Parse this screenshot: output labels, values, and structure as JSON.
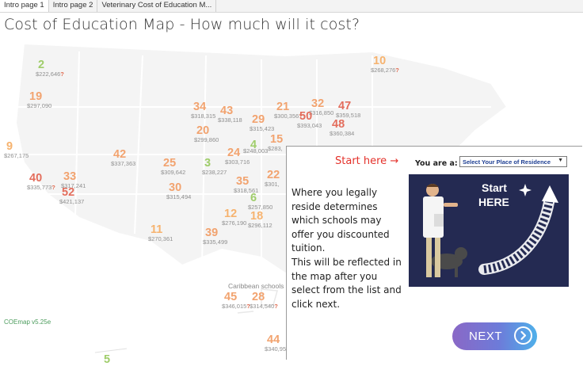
{
  "tabs": [
    "Intro page 1",
    "Intro page 2",
    "Veterinary Cost of Education M..."
  ],
  "title": "Cost of Education Map - How much will it cost?",
  "version": "COEmap v5.25e",
  "caribbean_label": "Caribbean schools",
  "colors": {
    "green": "#9fcd6a",
    "orange": "#f2a36f",
    "red": "#e36d5c",
    "panel_bg": "#242a52",
    "accent_red": "#e4322b",
    "select_text": "#1e3f93"
  },
  "map_markers": [
    {
      "id": "m2",
      "number": "2",
      "cost": "$222,646",
      "flag": "?",
      "color": "green"
    },
    {
      "id": "m10",
      "number": "10",
      "cost": "$268,276",
      "flag": "?",
      "color": "lorange"
    },
    {
      "id": "m19",
      "number": "19",
      "cost": "$297,090",
      "flag": "",
      "color": "orange"
    },
    {
      "id": "m34",
      "number": "34",
      "cost": "$318,315",
      "flag": "",
      "color": "orange"
    },
    {
      "id": "m43",
      "number": "43",
      "cost": "$338,118",
      "flag": "",
      "color": "orange"
    },
    {
      "id": "m21",
      "number": "21",
      "cost": "$300,356",
      "flag": "?",
      "color": "orange"
    },
    {
      "id": "m32",
      "number": "32",
      "cost": "$316,850",
      "flag": "",
      "color": "orange"
    },
    {
      "id": "m47",
      "number": "47",
      "cost": "$359,518",
      "flag": "",
      "color": "red"
    },
    {
      "id": "m29",
      "number": "29",
      "cost": "$315,423",
      "flag": "",
      "color": "orange"
    },
    {
      "id": "m50",
      "number": "50",
      "cost": "$393,043",
      "flag": "",
      "color": "red"
    },
    {
      "id": "m48",
      "number": "48",
      "cost": "$360,384",
      "flag": "",
      "color": "red"
    },
    {
      "id": "m20",
      "number": "20",
      "cost": "$299,860",
      "flag": "",
      "color": "orange"
    },
    {
      "id": "m15",
      "number": "15",
      "cost": "$283,",
      "flag": "",
      "color": "orange"
    },
    {
      "id": "m9",
      "number": "9",
      "cost": "$267,175",
      "flag": "",
      "color": "lorange"
    },
    {
      "id": "m4",
      "number": "4",
      "cost": "",
      "flag": "",
      "color": "green"
    },
    {
      "id": "m24",
      "number": "24",
      "cost": "$303,716",
      "flag": "",
      "color": "orange"
    },
    {
      "id": "m24b",
      "number": "",
      "cost": "$248,003",
      "flag": "",
      "color": "orange"
    },
    {
      "id": "m42",
      "number": "42",
      "cost": "$337,363",
      "flag": "",
      "color": "orange"
    },
    {
      "id": "m25",
      "number": "25",
      "cost": "$309,642",
      "flag": "",
      "color": "orange"
    },
    {
      "id": "m3",
      "number": "3",
      "cost": "$238,227",
      "flag": "",
      "color": "green"
    },
    {
      "id": "m22",
      "number": "22",
      "cost": "$301,",
      "flag": "",
      "color": "orange"
    },
    {
      "id": "m35",
      "number": "35",
      "cost": "$318,561",
      "flag": "",
      "color": "orange"
    },
    {
      "id": "m40",
      "number": "40",
      "cost": "$335,773",
      "flag": "?",
      "color": "red"
    },
    {
      "id": "m33",
      "number": "33",
      "cost": "$317,241",
      "flag": "",
      "color": "orange"
    },
    {
      "id": "m52",
      "number": "52",
      "cost": "$421,137",
      "flag": "",
      "color": "red"
    },
    {
      "id": "m30",
      "number": "30",
      "cost": "$315,494",
      "flag": "",
      "color": "orange"
    },
    {
      "id": "m6",
      "number": "6",
      "cost": "$257,850",
      "flag": "",
      "color": "green"
    },
    {
      "id": "m12",
      "number": "12",
      "cost": "$276,190",
      "flag": "",
      "color": "lorange"
    },
    {
      "id": "m18",
      "number": "18",
      "cost": "$296,112",
      "flag": "",
      "color": "lorange"
    },
    {
      "id": "m11",
      "number": "11",
      "cost": "$270,361",
      "flag": "",
      "color": "lorange"
    },
    {
      "id": "m39",
      "number": "39",
      "cost": "$335,499",
      "flag": "",
      "color": "orange"
    },
    {
      "id": "m45",
      "number": "45",
      "cost": "$346,015",
      "flag": "?",
      "color": "orange"
    },
    {
      "id": "m28",
      "number": "28",
      "cost": "$314,540",
      "flag": "?",
      "color": "orange"
    },
    {
      "id": "m44",
      "number": "44",
      "cost": "$340,95",
      "flag": "",
      "color": "orange"
    },
    {
      "id": "m5",
      "number": "5",
      "cost": "",
      "flag": "",
      "color": "green"
    }
  ],
  "panel": {
    "start_here": "Start here →",
    "you_are": "You are a:",
    "select_value": "Select Your Place of Residence",
    "para1": "Where you legally reside determines which schools may offer you discounted tuition.",
    "para2": "This will be reflected in the map after you select from the list and click next.",
    "illus_text1": "Start",
    "illus_text2": "HERE",
    "next_label": "NEXT"
  }
}
